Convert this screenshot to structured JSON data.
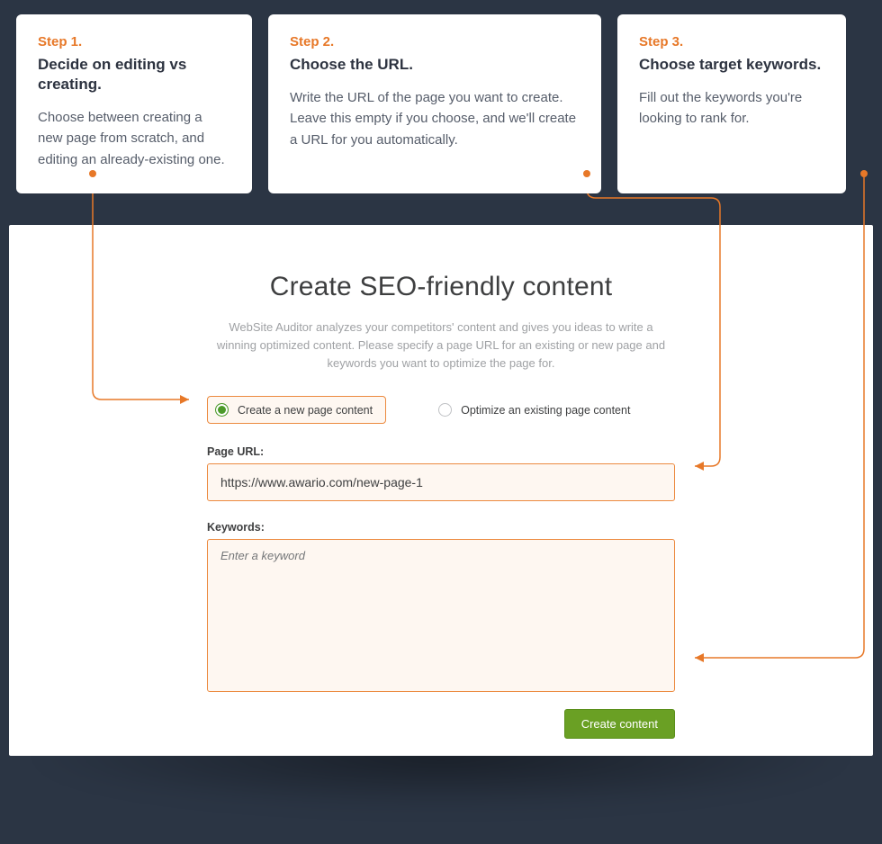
{
  "steps": [
    {
      "num": "Step 1.",
      "title": "Decide on editing vs creating.",
      "desc": "Choose between creating a new page from scratch, and editing an already-existing one."
    },
    {
      "num": "Step 2.",
      "title": "Choose the URL.",
      "desc": "Write the URL of the page you want to create. Leave this empty if you choose, and we'll create a URL for you automatically."
    },
    {
      "num": "Step 3.",
      "title": "Choose target keywords.",
      "desc": "Fill out the keywords you're looking to rank for."
    }
  ],
  "panel": {
    "heading": "Create SEO-friendly content",
    "subdesc": "WebSite Auditor analyzes your competitors' content and gives you ideas to write a winning optimized content. Please specify a page URL for an existing or new page and keywords you want to optimize the page for.",
    "radio_new": "Create a new page content",
    "radio_existing": "Optimize an existing page content",
    "url_label": "Page URL:",
    "url_value": "https://www.awario.com/new-page-1",
    "kw_label": "Keywords:",
    "kw_placeholder": "Enter a keyword",
    "create_btn": "Create content"
  },
  "colors": {
    "accent": "#e77828",
    "green": "#6aa024"
  }
}
